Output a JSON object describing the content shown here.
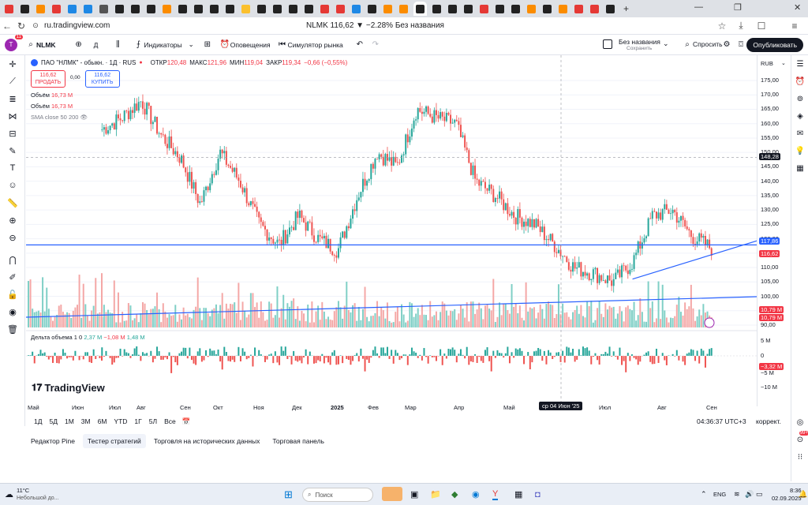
{
  "browser": {
    "url": "ru.tradingview.com",
    "page_title": "NLMK 116,62 ▼ −2.28% Без названия",
    "tab_colors": [
      "#e53935",
      "#222",
      "#fb8c00",
      "#e53935",
      "#1e88e5",
      "#1e88e5",
      "#555",
      "#222",
      "#222",
      "#222",
      "#fb8c00",
      "#222",
      "#222",
      "#222",
      "#222",
      "#fbc02d",
      "#222",
      "#222",
      "#222",
      "#222",
      "#e53935",
      "#e53935",
      "#1e88e5",
      "#222",
      "#fb8c00",
      "#fb8c00",
      "#222",
      "#222",
      "#222",
      "#222",
      "#e53935",
      "#222",
      "#222",
      "#fb8c00",
      "#222",
      "#fb8c00",
      "#e53935",
      "#e53935",
      "#222"
    ],
    "new_tab": "+"
  },
  "toolbar": {
    "avatar": "T",
    "avatar_badge": "11",
    "symbol": "NLMK",
    "interval": "Д",
    "indicators_label": "Индикаторы",
    "alerts_label": "Оповещения",
    "replay_label": "Симулятор рынка",
    "layout_name": "Без названия",
    "layout_saved": "Сохранить",
    "ask_label": "Спросить",
    "publish_label": "Опубликовать"
  },
  "legend": {
    "name": "ПАО \"НЛМК\" - обыкн. · 1Д · RUS",
    "open_label": "ОТКР",
    "open": "120,48",
    "high_label": "МАКС",
    "high": "121,96",
    "low_label": "МИН",
    "low": "119,04",
    "close_label": "ЗАКР",
    "close": "119,34",
    "change": "−0,66 (−0,55%)",
    "sell_price": "116,62",
    "sell_label": "ПРОДАТЬ",
    "spread": "0,00",
    "buy_price": "116,62",
    "buy_label": "КУПИТЬ",
    "vol1_label": "Объём",
    "vol1": "16,73 M",
    "vol2_label": "Объём",
    "vol2": "16,73 M",
    "sma_label": "SMA close 50 200"
  },
  "delta": {
    "label": "Дельта объема 1 0",
    "v1": "2,37 M",
    "v2": "−1,08 M",
    "v3": "1,48 M"
  },
  "price_axis": {
    "currency": "RUB",
    "ticks": [
      "175,00",
      "170,00",
      "165,00",
      "160,00",
      "155,00",
      "150,00",
      "145,00",
      "140,00",
      "135,00",
      "130,00",
      "125,00",
      "120,00",
      "115,00",
      "110,00",
      "105,00",
      "100,00",
      "95,00",
      "90,00"
    ],
    "crosshair_price": "148,28",
    "line_price": "117,86",
    "last_price": "116,62",
    "vol_label1": "10,79 M",
    "vol_label2": "10,79 M",
    "delta_ticks": [
      "5 M",
      "0",
      "−5 M",
      "−10 M"
    ],
    "delta_last": "−3,32 M"
  },
  "time_axis": {
    "labels": [
      "Май",
      "Июн",
      "Июл",
      "Авг",
      "Сен",
      "Окт",
      "Ноя",
      "Дек",
      "2025",
      "Фев",
      "Мар",
      "Апр",
      "Май",
      "Июл",
      "Авг",
      "Сен"
    ],
    "crosshair": "ср 04 Июн '25"
  },
  "bottom": {
    "ranges": [
      "1Д",
      "5Д",
      "1М",
      "3М",
      "6М",
      "YTD",
      "1Г",
      "5Л",
      "Все"
    ],
    "clock": "04:36:37 UTC+3",
    "adjust": "коррект.",
    "panels": [
      "Редактор Pine",
      "Тестер стратегий",
      "Торговля на исторических данных",
      "Торговая панель"
    ]
  },
  "branding": "TradingView",
  "taskbar": {
    "weather_temp": "11°C",
    "weather_text": "Небольшой до...",
    "search_placeholder": "Поиск",
    "lang": "ENG",
    "time": "8:36",
    "date": "02.09.2025"
  },
  "chart_data": {
    "type": "candlestick",
    "title": "NLMK 1D",
    "x_range": [
      "2024-05",
      "2025-09"
    ],
    "ylim": [
      90,
      175
    ],
    "close_series": [
      {
        "date": "2024-06",
        "close": 158
      },
      {
        "date": "2024-07",
        "close": 162
      },
      {
        "date": "2024-07-15",
        "close": 168
      },
      {
        "date": "2024-08",
        "close": 156
      },
      {
        "date": "2024-08-20",
        "close": 148
      },
      {
        "date": "2024-09",
        "close": 132
      },
      {
        "date": "2024-09-20",
        "close": 150
      },
      {
        "date": "2024-10",
        "close": 140
      },
      {
        "date": "2024-10-20",
        "close": 125
      },
      {
        "date": "2024-11",
        "close": 118
      },
      {
        "date": "2024-11-20",
        "close": 128
      },
      {
        "date": "2024-12",
        "close": 120
      },
      {
        "date": "2024-12-20",
        "close": 116
      },
      {
        "date": "2025-01",
        "close": 135
      },
      {
        "date": "2025-01-20",
        "close": 150
      },
      {
        "date": "2025-02",
        "close": 145
      },
      {
        "date": "2025-02-20",
        "close": 165
      },
      {
        "date": "2025-03",
        "close": 162
      },
      {
        "date": "2025-03-20",
        "close": 160
      },
      {
        "date": "2025-04",
        "close": 140
      },
      {
        "date": "2025-04-20",
        "close": 135
      },
      {
        "date": "2025-05",
        "close": 128
      },
      {
        "date": "2025-05-20",
        "close": 125
      },
      {
        "date": "2025-06",
        "close": 118
      },
      {
        "date": "2025-06-20",
        "close": 110
      },
      {
        "date": "2025-07",
        "close": 108
      },
      {
        "date": "2025-07-20",
        "close": 105
      },
      {
        "date": "2025-08",
        "close": 112
      },
      {
        "date": "2025-08-10",
        "close": 128
      },
      {
        "date": "2025-08-20",
        "close": 130
      },
      {
        "date": "2025-08-28",
        "close": 121
      },
      {
        "date": "2025-09-02",
        "close": 116.62
      }
    ],
    "horizontal_line": 117.86,
    "trendline_points": [
      [
        0.83,
        106
      ],
      [
        0.99,
        121
      ]
    ],
    "colors": {
      "up": "#26a69a",
      "down": "#ef5350",
      "line": "#2962ff"
    }
  }
}
